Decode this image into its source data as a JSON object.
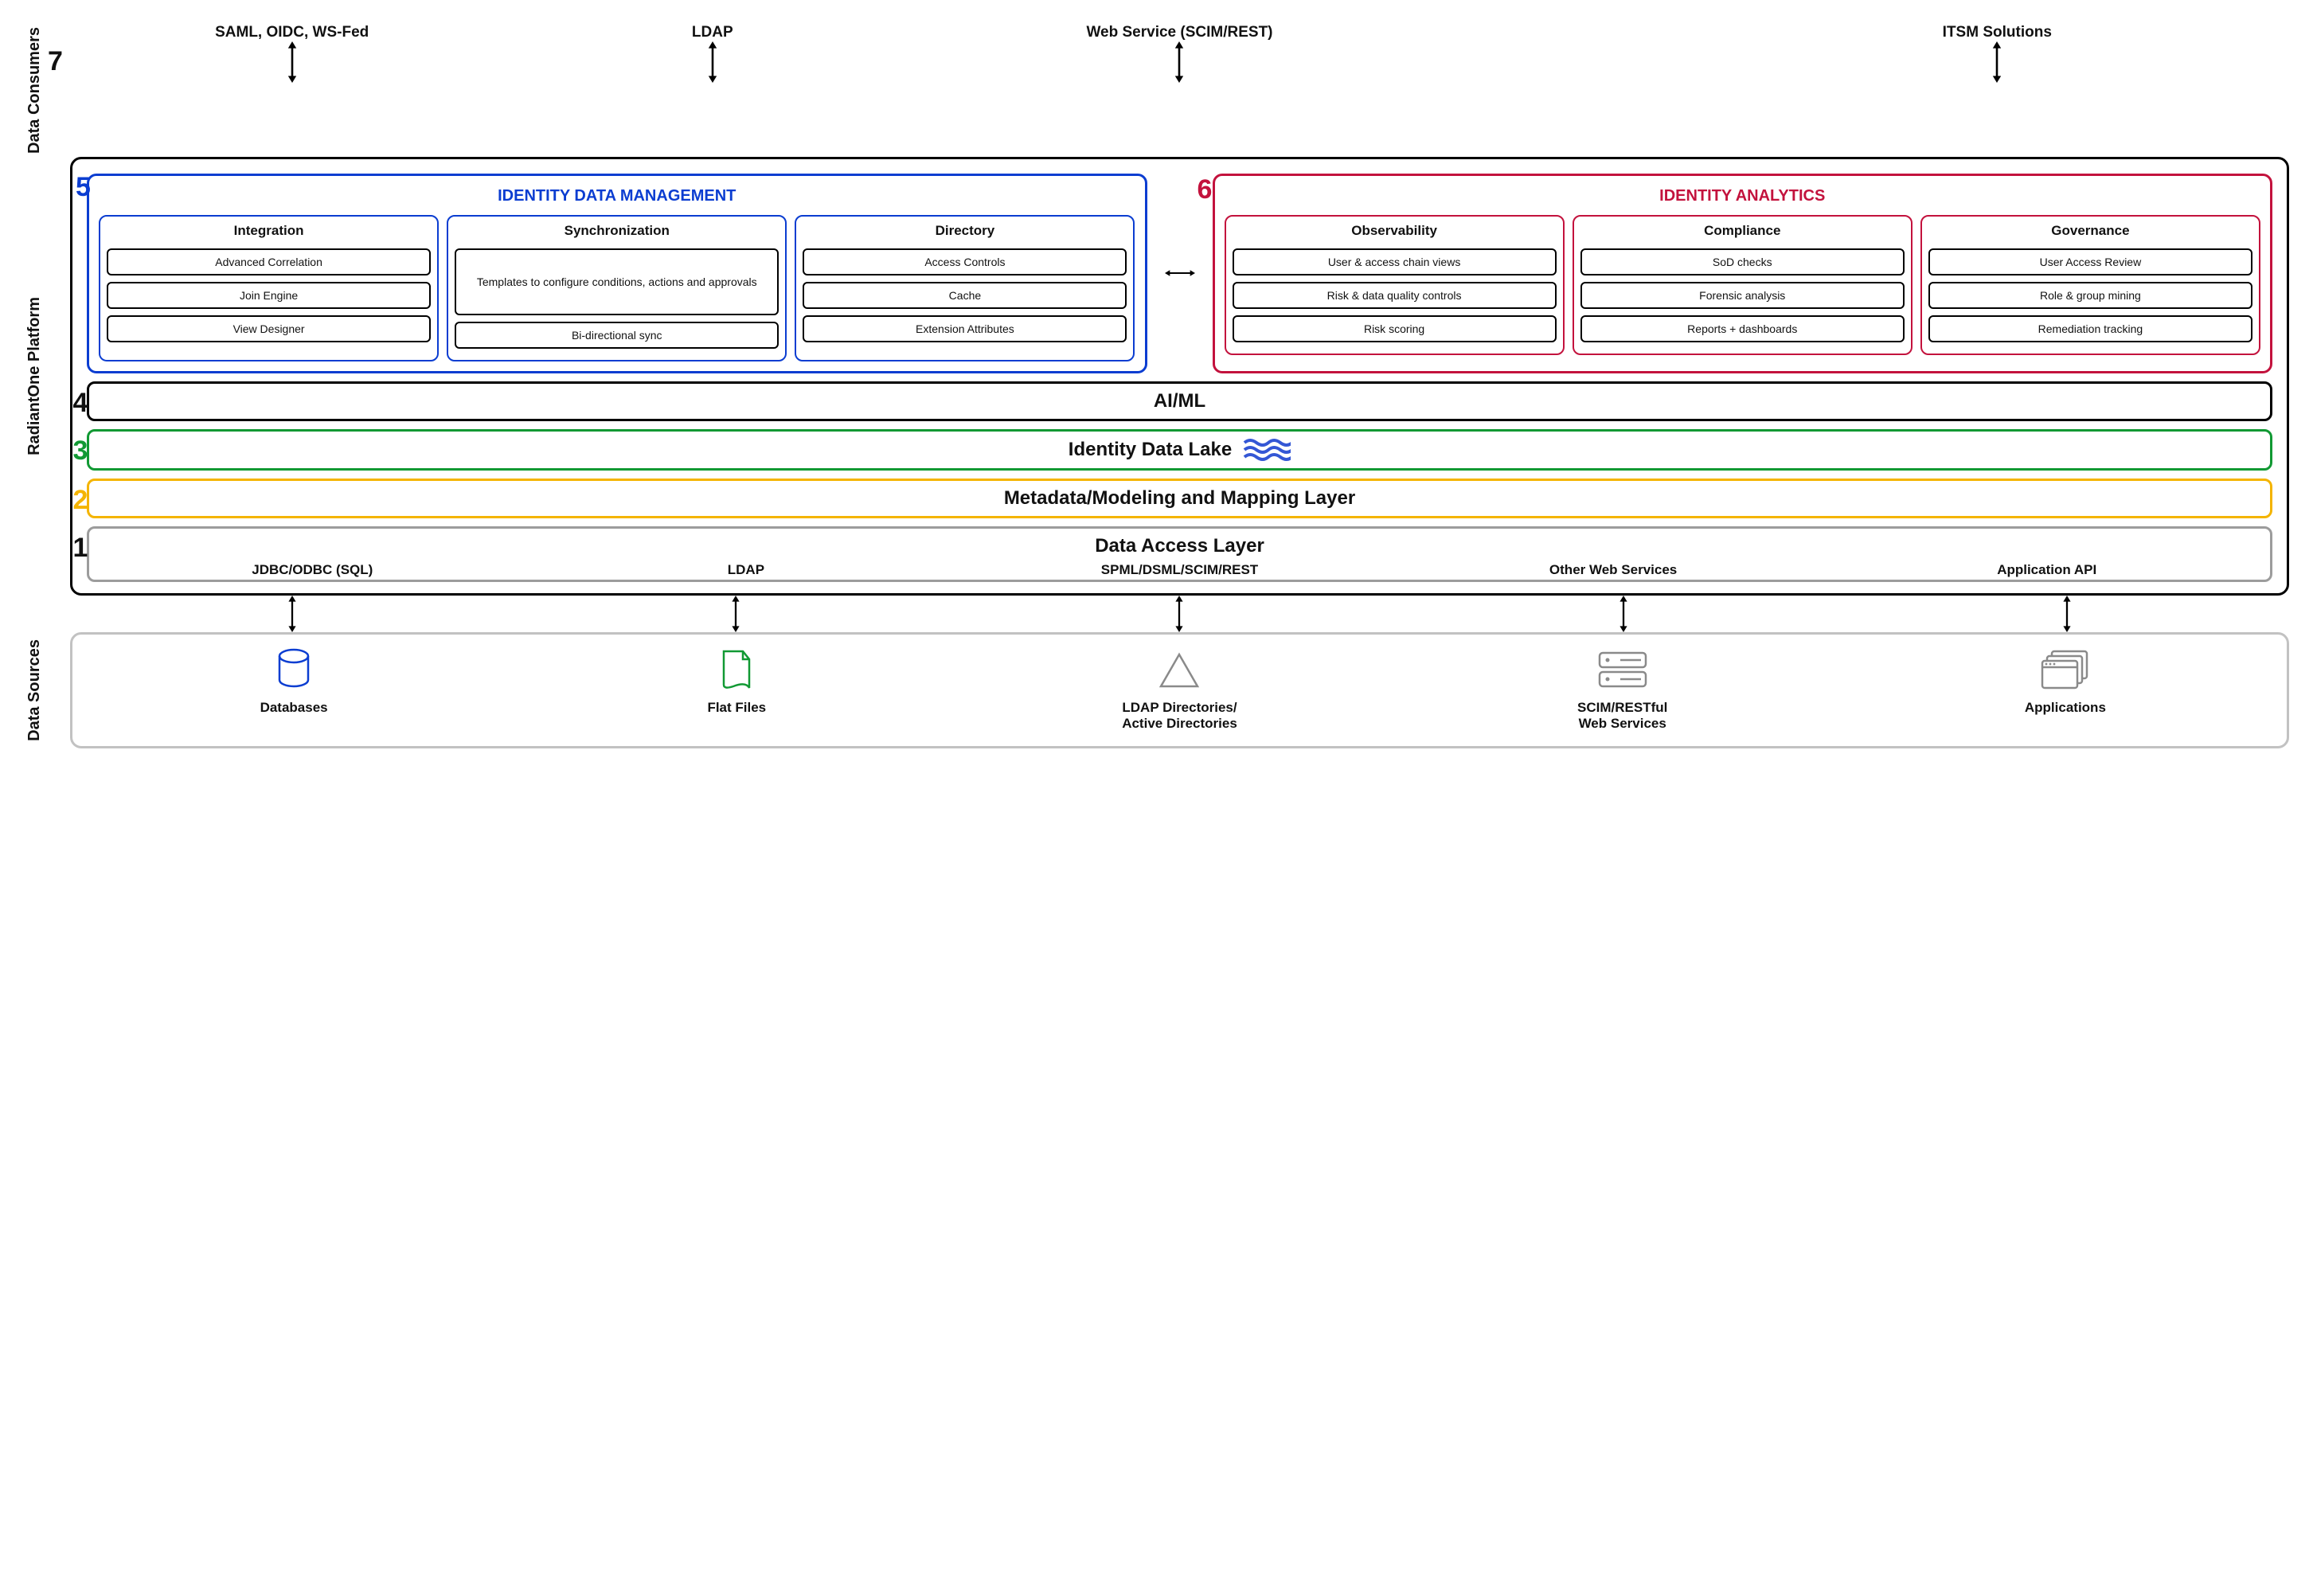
{
  "sections": {
    "consumers": "Data Consumers",
    "platform": "RadiantOne Platform",
    "sources": "Data Sources"
  },
  "numbers": {
    "n1": "1",
    "n2": "2",
    "n3": "3",
    "n4": "4",
    "n5": "5",
    "n6": "6",
    "n7": "7"
  },
  "consumers": {
    "saml": "SAML, OIDC, WS-Fed",
    "ldap": "LDAP",
    "web": "Web Service (SCIM/REST)",
    "itsm": "ITSM Solutions"
  },
  "idm": {
    "title": "IDENTITY DATA MANAGEMENT",
    "integration": {
      "title": "Integration",
      "advanced": "Advanced Correlation",
      "join": "Join Engine",
      "view": "View Designer"
    },
    "sync": {
      "title": "Synchronization",
      "templates": "Templates to configure conditions, actions and approvals",
      "bidir": "Bi-directional sync"
    },
    "directory": {
      "title": "Directory",
      "access": "Access Controls",
      "cache": "Cache",
      "ext": "Extension Attributes"
    }
  },
  "analytics": {
    "title": "IDENTITY ANALYTICS",
    "obs": {
      "title": "Observability",
      "chain": "User & access chain views",
      "risk": "Risk & data quality controls",
      "score": "Risk scoring"
    },
    "comp": {
      "title": "Compliance",
      "sod": "SoD checks",
      "forensic": "Forensic analysis",
      "reports": "Reports + dashboards"
    },
    "gov": {
      "title": "Governance",
      "uar": "User Access Review",
      "mining": "Role & group mining",
      "remed": "Remediation tracking"
    }
  },
  "layers": {
    "aiml": "AI/ML",
    "lake": "Identity Data Lake",
    "meta": "Metadata/Modeling and Mapping Layer",
    "dal": "Data Access Layer"
  },
  "dal_labels": {
    "jdbc": "JDBC/ODBC (SQL)",
    "ldap": "LDAP",
    "spml": "SPML/DSML/SCIM/REST",
    "other": "Other Web Services",
    "api": "Application API"
  },
  "sources": {
    "db": "Databases",
    "flat": "Flat Files",
    "ldap": "LDAP Directories/\nActive Directories",
    "scim": "SCIM/RESTful\nWeb Services",
    "apps": "Applications"
  }
}
